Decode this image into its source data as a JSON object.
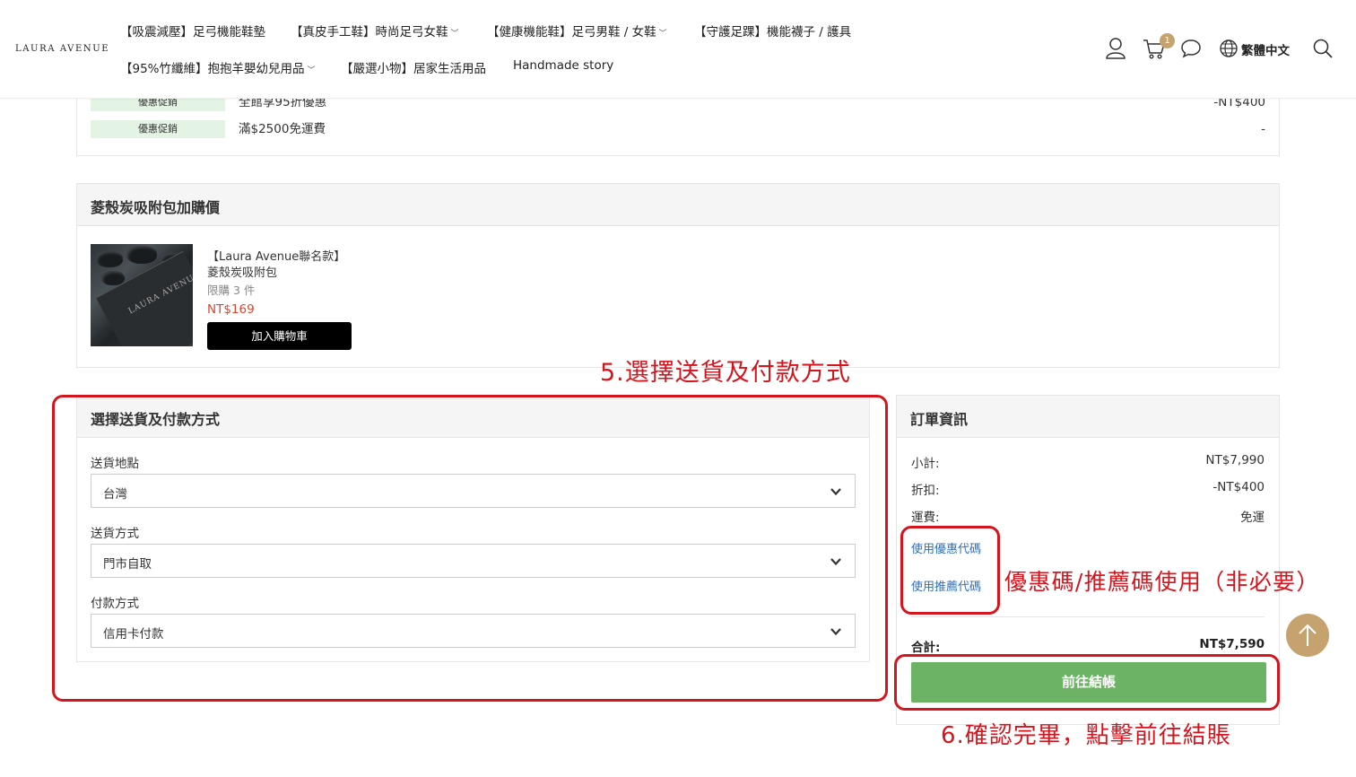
{
  "header": {
    "logo": "LAURA AVENUE",
    "nav": [
      {
        "label": "【吸震減壓】足弓機能鞋墊",
        "has_dropdown": false
      },
      {
        "label": "【真皮手工鞋】時尚足弓女鞋",
        "has_dropdown": true
      },
      {
        "label": "【健康機能鞋】足弓男鞋 / 女鞋",
        "has_dropdown": true
      },
      {
        "label": "【守護足踝】機能襪子 / 護具",
        "has_dropdown": false
      },
      {
        "label": "【95%竹纖維】抱抱羊嬰幼兒用品",
        "has_dropdown": true
      },
      {
        "label": "【嚴選小物】居家生活用品",
        "has_dropdown": false
      },
      {
        "label": "Handmade story",
        "has_dropdown": false
      }
    ],
    "icons": [
      "user-icon",
      "cart-icon",
      "chat-icon",
      "globe-icon",
      "search-icon"
    ],
    "cart_count": "1",
    "language": "繁體中文"
  },
  "promotions": [
    {
      "badge": "優惠促銷",
      "text": "全館享95折優惠",
      "value": "-NT$400"
    },
    {
      "badge": "優惠促銷",
      "text": "滿$2500免運費",
      "value": "-"
    }
  ],
  "addon": {
    "title": "菱殼炭吸附包加購價",
    "image_brand": "LAURA AVENUE",
    "name_line1": "【Laura Avenue聯名款】",
    "name_line2": "菱殼炭吸附包",
    "limit": "限購 3 件",
    "price": "NT$169",
    "button": "加入購物車"
  },
  "shipping": {
    "title": "選擇送貨及付款方式",
    "destination_label": "送貨地點",
    "destination_value": "台灣",
    "method_label": "送貨方式",
    "method_value": "門市自取",
    "payment_label": "付款方式",
    "payment_value": "信用卡付款"
  },
  "order": {
    "title": "訂單資訊",
    "subtotal_label": "小計:",
    "subtotal_value": "NT$7,990",
    "discount_label": "折扣:",
    "discount_value": "-NT$400",
    "shipping_label": "運費:",
    "shipping_value": "免運",
    "coupon_link": "使用優惠代碼",
    "referral_link": "使用推薦代碼",
    "total_label": "合計:",
    "total_value": "NT$7,590",
    "checkout_button": "前往結帳"
  },
  "annotations": {
    "step5": "5.選擇送貨及付款方式",
    "coupon_note": "優惠碼/推薦碼使用（非必要）",
    "step6": "6.確認完畢，點擊前往結賬"
  },
  "colors": {
    "accent_red": "#d6141d",
    "checkout_green": "#6db365",
    "gold": "#c6a26e",
    "price_red": "#d9462f",
    "link_blue": "#2f6fb6"
  }
}
